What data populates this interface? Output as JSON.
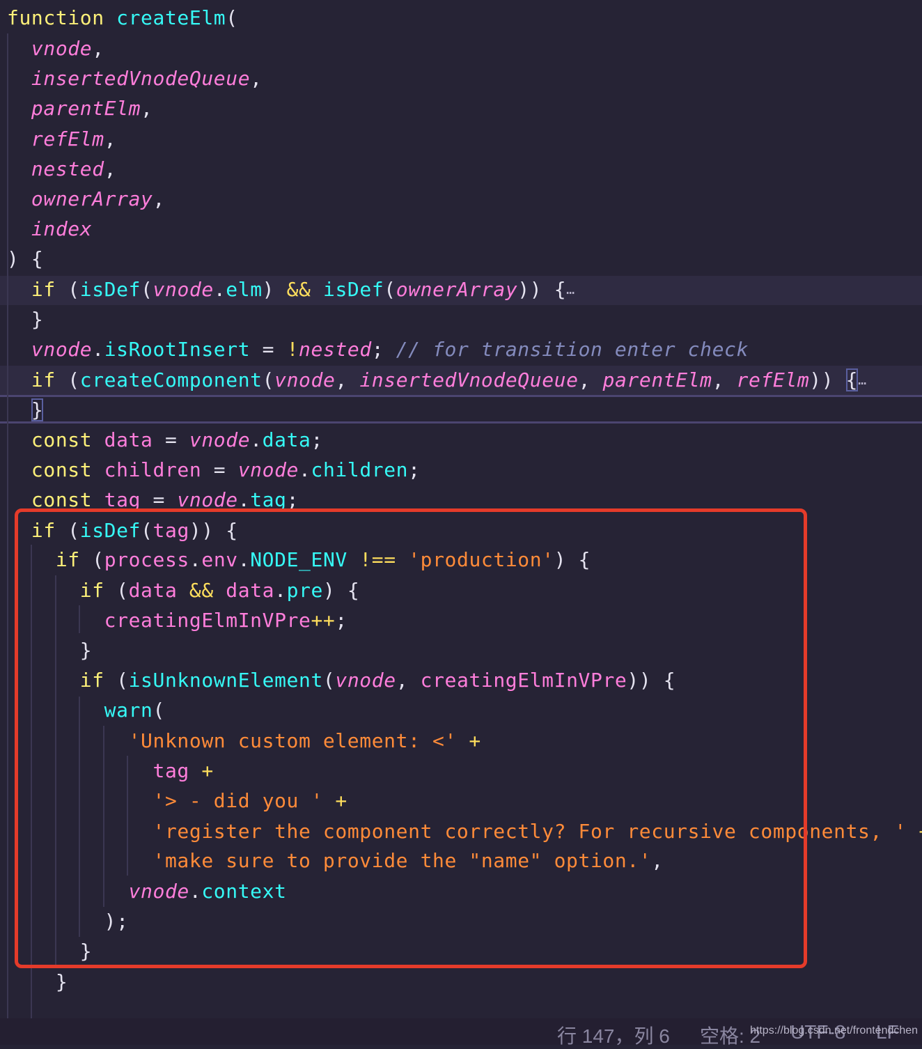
{
  "editor": {
    "lines": [
      [
        [
          "kw",
          "function "
        ],
        [
          "fn",
          "createElm"
        ],
        [
          "pun",
          "("
        ]
      ],
      [
        [
          "pun",
          "  "
        ],
        [
          "param",
          "vnode"
        ],
        [
          "pun",
          ","
        ]
      ],
      [
        [
          "pun",
          "  "
        ],
        [
          "param",
          "insertedVnodeQueue"
        ],
        [
          "pun",
          ","
        ]
      ],
      [
        [
          "pun",
          "  "
        ],
        [
          "param",
          "parentElm"
        ],
        [
          "pun",
          ","
        ]
      ],
      [
        [
          "pun",
          "  "
        ],
        [
          "param",
          "refElm"
        ],
        [
          "pun",
          ","
        ]
      ],
      [
        [
          "pun",
          "  "
        ],
        [
          "param",
          "nested"
        ],
        [
          "pun",
          ","
        ]
      ],
      [
        [
          "pun",
          "  "
        ],
        [
          "param",
          "ownerArray"
        ],
        [
          "pun",
          ","
        ]
      ],
      [
        [
          "pun",
          "  "
        ],
        [
          "param",
          "index"
        ]
      ],
      [
        [
          "pun",
          ") {"
        ]
      ],
      [
        [
          "pun",
          "  "
        ],
        [
          "kw",
          "if"
        ],
        [
          "pun",
          " ("
        ],
        [
          "fn",
          "isDef"
        ],
        [
          "pun",
          "("
        ],
        [
          "param",
          "vnode"
        ],
        [
          "pun",
          "."
        ],
        [
          "prop",
          "elm"
        ],
        [
          "pun",
          ") "
        ],
        [
          "op",
          "&&"
        ],
        [
          "pun",
          " "
        ],
        [
          "fn",
          "isDef"
        ],
        [
          "pun",
          "("
        ],
        [
          "param",
          "ownerArray"
        ],
        [
          "pun",
          ")) {"
        ],
        [
          "fold",
          "…"
        ]
      ],
      [
        [
          "pun",
          "  }"
        ]
      ],
      [
        [
          "pun",
          "  "
        ],
        [
          "param",
          "vnode"
        ],
        [
          "pun",
          "."
        ],
        [
          "prop",
          "isRootInsert"
        ],
        [
          "pun",
          " = "
        ],
        [
          "op",
          "!"
        ],
        [
          "param",
          "nested"
        ],
        [
          "pun",
          "; "
        ],
        [
          "cmt",
          "// for transition enter check"
        ]
      ],
      [
        [
          "pun",
          "  "
        ],
        [
          "kw",
          "if"
        ],
        [
          "pun",
          " ("
        ],
        [
          "fn",
          "createComponent"
        ],
        [
          "pun",
          "("
        ],
        [
          "param",
          "vnode"
        ],
        [
          "pun",
          ", "
        ],
        [
          "param",
          "insertedVnodeQueue"
        ],
        [
          "pun",
          ", "
        ],
        [
          "param",
          "parentElm"
        ],
        [
          "pun",
          ", "
        ],
        [
          "param",
          "refElm"
        ],
        [
          "pun",
          ")) "
        ],
        [
          "brmatch",
          "{"
        ],
        [
          "fold",
          "…"
        ]
      ],
      [
        [
          "pun",
          "  "
        ],
        [
          "brmatch",
          "}"
        ]
      ],
      [
        [
          "pun",
          "  "
        ],
        [
          "kw",
          "const "
        ],
        [
          "var",
          "data"
        ],
        [
          "pun",
          " = "
        ],
        [
          "param",
          "vnode"
        ],
        [
          "pun",
          "."
        ],
        [
          "prop",
          "data"
        ],
        [
          "pun",
          ";"
        ]
      ],
      [
        [
          "pun",
          "  "
        ],
        [
          "kw",
          "const "
        ],
        [
          "var",
          "children"
        ],
        [
          "pun",
          " = "
        ],
        [
          "param",
          "vnode"
        ],
        [
          "pun",
          "."
        ],
        [
          "prop",
          "children"
        ],
        [
          "pun",
          ";"
        ]
      ],
      [
        [
          "pun",
          "  "
        ],
        [
          "kw",
          "const "
        ],
        [
          "var",
          "tag"
        ],
        [
          "pun",
          " = "
        ],
        [
          "param",
          "vnode"
        ],
        [
          "pun",
          "."
        ],
        [
          "prop",
          "tag"
        ],
        [
          "pun",
          ";"
        ]
      ],
      [
        [
          "pun",
          "  "
        ],
        [
          "kw",
          "if"
        ],
        [
          "pun",
          " ("
        ],
        [
          "fn",
          "isDef"
        ],
        [
          "pun",
          "("
        ],
        [
          "var",
          "tag"
        ],
        [
          "pun",
          ")) {"
        ]
      ],
      [
        [
          "pun",
          "    "
        ],
        [
          "kw",
          "if"
        ],
        [
          "pun",
          " ("
        ],
        [
          "var",
          "process"
        ],
        [
          "pun",
          "."
        ],
        [
          "var",
          "env"
        ],
        [
          "pun",
          "."
        ],
        [
          "prop",
          "NODE_ENV"
        ],
        [
          "pun",
          " "
        ],
        [
          "op",
          "!=="
        ],
        [
          "pun",
          " "
        ],
        [
          "str",
          "'production'"
        ],
        [
          "pun",
          ") {"
        ]
      ],
      [
        [
          "pun",
          "      "
        ],
        [
          "kw",
          "if"
        ],
        [
          "pun",
          " ("
        ],
        [
          "var",
          "data"
        ],
        [
          "pun",
          " "
        ],
        [
          "op",
          "&&"
        ],
        [
          "pun",
          " "
        ],
        [
          "var",
          "data"
        ],
        [
          "pun",
          "."
        ],
        [
          "prop",
          "pre"
        ],
        [
          "pun",
          ") {"
        ]
      ],
      [
        [
          "pun",
          "        "
        ],
        [
          "var",
          "creatingElmInVPre"
        ],
        [
          "op",
          "++"
        ],
        [
          "pun",
          ";"
        ]
      ],
      [
        [
          "pun",
          "      }"
        ]
      ],
      [
        [
          "pun",
          "      "
        ],
        [
          "kw",
          "if"
        ],
        [
          "pun",
          " ("
        ],
        [
          "fn",
          "isUnknownElement"
        ],
        [
          "pun",
          "("
        ],
        [
          "param",
          "vnode"
        ],
        [
          "pun",
          ", "
        ],
        [
          "var",
          "creatingElmInVPre"
        ],
        [
          "pun",
          ")) {"
        ]
      ],
      [
        [
          "pun",
          "        "
        ],
        [
          "fn",
          "warn"
        ],
        [
          "pun",
          "("
        ]
      ],
      [
        [
          "pun",
          "          "
        ],
        [
          "str",
          "'Unknown custom element: <'"
        ],
        [
          "pun",
          " "
        ],
        [
          "op",
          "+"
        ]
      ],
      [
        [
          "pun",
          "            "
        ],
        [
          "var",
          "tag"
        ],
        [
          "pun",
          " "
        ],
        [
          "op",
          "+"
        ]
      ],
      [
        [
          "pun",
          "            "
        ],
        [
          "str",
          "'> - did you '"
        ],
        [
          "pun",
          " "
        ],
        [
          "op",
          "+"
        ]
      ],
      [
        [
          "pun",
          "            "
        ],
        [
          "str",
          "'register the component correctly? For recursive components, '"
        ],
        [
          "pun",
          " "
        ],
        [
          "op",
          "+"
        ]
      ],
      [
        [
          "pun",
          "            "
        ],
        [
          "str",
          "'make sure to provide the \"name\" option.'"
        ],
        [
          "pun",
          ","
        ]
      ],
      [
        [
          "pun",
          "          "
        ],
        [
          "param",
          "vnode"
        ],
        [
          "pun",
          "."
        ],
        [
          "prop",
          "context"
        ]
      ],
      [
        [
          "pun",
          "        );"
        ]
      ],
      [
        [
          "pun",
          "      }"
        ]
      ],
      [
        [
          "pun",
          "    }"
        ]
      ]
    ]
  },
  "statusbar": {
    "position": "行 147，列 6",
    "indent": "空格: 2",
    "encoding": "UTF-8",
    "eol": "LF"
  },
  "watermark": "https://blog.csdn.net/frontendchen",
  "colors": {
    "background": "#262335",
    "keyword": "#fdf079",
    "function": "#36f9f6",
    "parameter": "#ff7edb",
    "string": "#ff8b39",
    "comment": "#848bbd",
    "annotation_border": "#e53b2a"
  }
}
